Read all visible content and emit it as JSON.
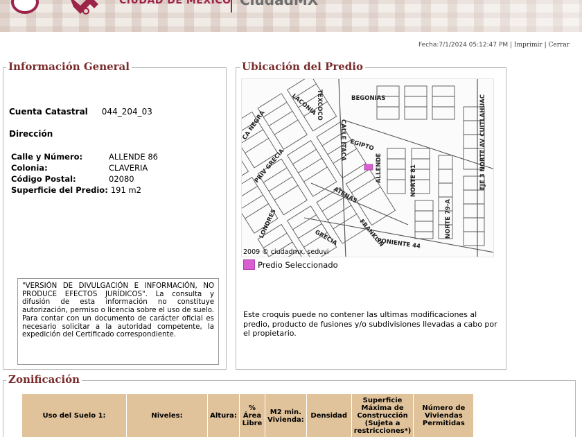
{
  "header": {
    "city_text": "CIUDAD DE MÉXICO",
    "app_name": "CiudadMX",
    "brand_color": "#9d2449"
  },
  "topbar": {
    "date_label": "Fecha:",
    "date_value": "7/1/2024 05:12:47 PM",
    "sep": "|",
    "print_link": "Imprimir",
    "close_link": "Cerrar"
  },
  "info": {
    "legend": "Información General",
    "cuenta_label": "Cuenta Catastral",
    "cuenta_value": "044_204_03",
    "direccion_title": "Dirección",
    "calle_label": "Calle y Número:",
    "calle_value": "ALLENDE 86",
    "colonia_label": "Colonia:",
    "colonia_value": "CLAVERIA",
    "cp_label": "Código Postal:",
    "cp_value": "02080",
    "superficie_label": "Superficie del Predio:",
    "superficie_value": "191 m2",
    "disclaimer": "\"VERSIÓN DE DIVULGACIÓN E INFORMACIÓN, NO PRODUCE EFECTOS JURÍDICOS\". La consulta y difusión de esta información no constituye autorización, permiso o licencia sobre el uso de suelo. Para contar con un documento de carácter oficial es necesario solicitar a la autoridad competente, la expedición del Certificado correspondiente."
  },
  "ubicacion": {
    "legend": "Ubicación del Predio",
    "map_credit": "2009 © ciudadmx, seduvi",
    "legend_item": "Predio Seleccionado",
    "legend_color": "#d85fd0",
    "croquis_note": "Este croquis puede no contener las ultimas modificaciones al predio, producto de fusiones y/o subdivisiones llevadas a cabo por el propietario.",
    "streets": {
      "laconia": "LACONIA",
      "texcoco": "TEXCOCO",
      "begonias": "BEGONIAS",
      "ca_negra": "CA NEGRA",
      "calle_itaca": "CALLE ITACA",
      "egipto": "EGIPTO",
      "priv_grecia": "PRIV GRECIA",
      "allende": "ALLENDE",
      "norte_81": "NORTE 81",
      "eje3": "EJE 3 NORTE AV CUITLAHUAC",
      "atenas": "ATENAS",
      "londres": "LONDRES",
      "franklin": "FRANKLIN",
      "norte_79a": "NORTE 79-A",
      "grecia": "GRECIA",
      "poniente_44": "PONIENTE 44"
    }
  },
  "zonificacion": {
    "legend": "Zonificación",
    "columns": [
      "Uso del Suelo 1:",
      "Niveles:",
      "Altura:",
      "% Área Libre",
      "M2 min. Vivienda:",
      "Densidad",
      "Superficie Máxima de Construcción (Sujeta a restricciones*)",
      "Número de Viviendas Permitidas"
    ]
  }
}
